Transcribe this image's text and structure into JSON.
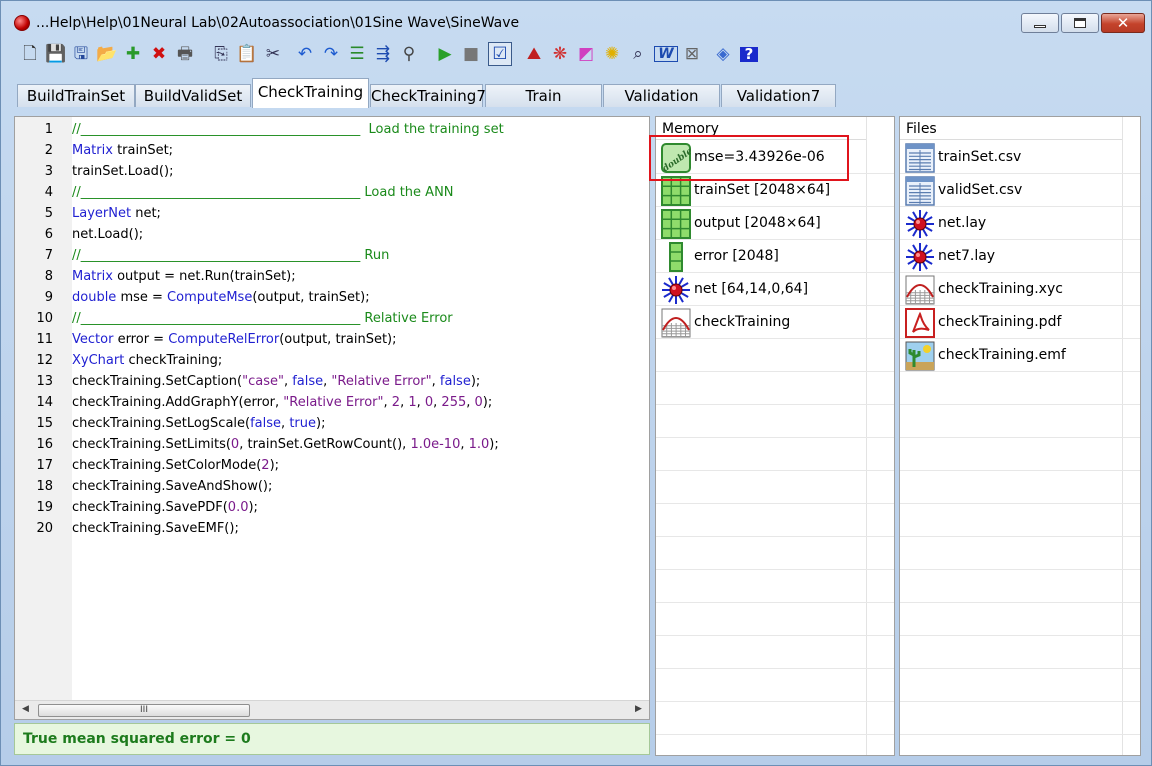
{
  "window": {
    "title": "...Help\\Help\\01Neural Lab\\02Autoassociation\\01Sine Wave\\SineWave",
    "close_glyph": "✕"
  },
  "toolbar": {
    "icons": [
      "new-file-icon",
      "save-icon",
      "save-as-icon",
      "open-folder-icon",
      "add-icon",
      "delete-icon",
      "print-icon",
      "copy-icon",
      "paste-icon",
      "cut-icon",
      "undo-icon",
      "redo-icon",
      "format-icon",
      "indent-icon",
      "help-search-icon",
      "run-icon",
      "stop-icon",
      "check-icon",
      "chart-icon",
      "palette-icon",
      "rainbow-icon",
      "lightbulb-icon",
      "preview-icon",
      "word-icon",
      "close-doc-icon",
      "book-icon",
      "help-icon"
    ]
  },
  "tabs": [
    "BuildTrainSet",
    "BuildValidSet",
    "CheckTraining",
    "CheckTraining7",
    "Train",
    "Validation",
    "Validation7"
  ],
  "active_tab": "CheckTraining",
  "code": {
    "line_numbers": [
      "1",
      "2",
      "3",
      "4",
      "5",
      "6",
      "7",
      "8",
      "9",
      "10",
      "11",
      "12",
      "13",
      "14",
      "15",
      "16",
      "17",
      "18",
      "19",
      "20"
    ],
    "lines": [
      [
        {
          "t": "//___________________________________________  Load the training set",
          "c": "cm"
        }
      ],
      [
        {
          "t": "Matrix",
          "c": "kw"
        },
        {
          "t": " trainSet;",
          "c": ""
        }
      ],
      [
        {
          "t": "trainSet.Load();",
          "c": ""
        }
      ],
      [
        {
          "t": "//___________________________________________ Load the ANN",
          "c": "cm"
        }
      ],
      [
        {
          "t": "LayerNet",
          "c": "kw"
        },
        {
          "t": " net;",
          "c": ""
        }
      ],
      [
        {
          "t": "net.Load();",
          "c": ""
        }
      ],
      [
        {
          "t": "//___________________________________________ Run",
          "c": "cm"
        }
      ],
      [
        {
          "t": "Matrix",
          "c": "kw"
        },
        {
          "t": " output = net.Run(trainSet);",
          "c": ""
        }
      ],
      [
        {
          "t": "double",
          "c": "kw"
        },
        {
          "t": " mse = ",
          "c": ""
        },
        {
          "t": "ComputeMse",
          "c": "kw"
        },
        {
          "t": "(output, trainSet);",
          "c": ""
        }
      ],
      [
        {
          "t": "//___________________________________________ Relative Error",
          "c": "cm"
        }
      ],
      [
        {
          "t": "Vector",
          "c": "kw"
        },
        {
          "t": " error = ",
          "c": ""
        },
        {
          "t": "ComputeRelError",
          "c": "kw"
        },
        {
          "t": "(output, trainSet);",
          "c": ""
        }
      ],
      [
        {
          "t": "XyChart",
          "c": "kw"
        },
        {
          "t": " checkTraining;",
          "c": ""
        }
      ],
      [
        {
          "t": "checkTraining.SetCaption(",
          "c": ""
        },
        {
          "t": "\"case\"",
          "c": "st"
        },
        {
          "t": ", ",
          "c": ""
        },
        {
          "t": "false",
          "c": "kw"
        },
        {
          "t": ", ",
          "c": ""
        },
        {
          "t": "\"Relative Error\"",
          "c": "st"
        },
        {
          "t": ", ",
          "c": ""
        },
        {
          "t": "false",
          "c": "kw"
        },
        {
          "t": ");",
          "c": ""
        }
      ],
      [
        {
          "t": "checkTraining.AddGraphY(error, ",
          "c": ""
        },
        {
          "t": "\"Relative Error\"",
          "c": "st"
        },
        {
          "t": ", ",
          "c": ""
        },
        {
          "t": "2",
          "c": "nu"
        },
        {
          "t": ", ",
          "c": ""
        },
        {
          "t": "1",
          "c": "nu"
        },
        {
          "t": ", ",
          "c": ""
        },
        {
          "t": "0",
          "c": "nu"
        },
        {
          "t": ", ",
          "c": ""
        },
        {
          "t": "255",
          "c": "nu"
        },
        {
          "t": ", ",
          "c": ""
        },
        {
          "t": "0",
          "c": "nu"
        },
        {
          "t": ");",
          "c": ""
        }
      ],
      [
        {
          "t": "checkTraining.SetLogScale(",
          "c": ""
        },
        {
          "t": "false",
          "c": "kw"
        },
        {
          "t": ", ",
          "c": ""
        },
        {
          "t": "true",
          "c": "kw"
        },
        {
          "t": ");",
          "c": ""
        }
      ],
      [
        {
          "t": "checkTraining.SetLimits(",
          "c": ""
        },
        {
          "t": "0",
          "c": "nu"
        },
        {
          "t": ", trainSet.GetRowCount(), ",
          "c": ""
        },
        {
          "t": "1.0e-10",
          "c": "nu"
        },
        {
          "t": ", ",
          "c": ""
        },
        {
          "t": "1.0",
          "c": "nu"
        },
        {
          "t": ");",
          "c": ""
        }
      ],
      [
        {
          "t": "checkTraining.SetColorMode(",
          "c": ""
        },
        {
          "t": "2",
          "c": "nu"
        },
        {
          "t": ");",
          "c": ""
        }
      ],
      [
        {
          "t": "checkTraining.SaveAndShow();",
          "c": ""
        }
      ],
      [
        {
          "t": "checkTraining.SavePDF(",
          "c": ""
        },
        {
          "t": "0.0",
          "c": "nu"
        },
        {
          "t": ");",
          "c": ""
        }
      ],
      [
        {
          "t": "checkTraining.SaveEMF();",
          "c": ""
        }
      ]
    ]
  },
  "scrollbar": {
    "left_arrow": "◀",
    "right_arrow": "▶",
    "thumb_grip": "III"
  },
  "status": {
    "text": "True mean squared error = 0"
  },
  "memory": {
    "header": "Memory",
    "items": [
      {
        "label": "mse=3.43926e-06",
        "icon": "double-icon",
        "icon_text": "double"
      },
      {
        "label": "trainSet [2048×64]",
        "icon": "matrix-icon"
      },
      {
        "label": "output [2048×64]",
        "icon": "matrix-icon"
      },
      {
        "label": "error [2048]",
        "icon": "vector-icon"
      },
      {
        "label": "net [64,14,0,64]",
        "icon": "neural-net-icon"
      },
      {
        "label": "checkTraining",
        "icon": "chart-icon"
      }
    ]
  },
  "files": {
    "header": "Files",
    "items": [
      {
        "label": "trainSet.csv",
        "icon": "csv-file-icon"
      },
      {
        "label": "validSet.csv",
        "icon": "csv-file-icon"
      },
      {
        "label": "net.lay",
        "icon": "neural-net-icon"
      },
      {
        "label": "net7.lay",
        "icon": "neural-net-icon"
      },
      {
        "label": "checkTraining.xyc",
        "icon": "chart-icon"
      },
      {
        "label": "checkTraining.pdf",
        "icon": "pdf-file-icon"
      },
      {
        "label": "checkTraining.emf",
        "icon": "emf-file-icon"
      }
    ]
  }
}
